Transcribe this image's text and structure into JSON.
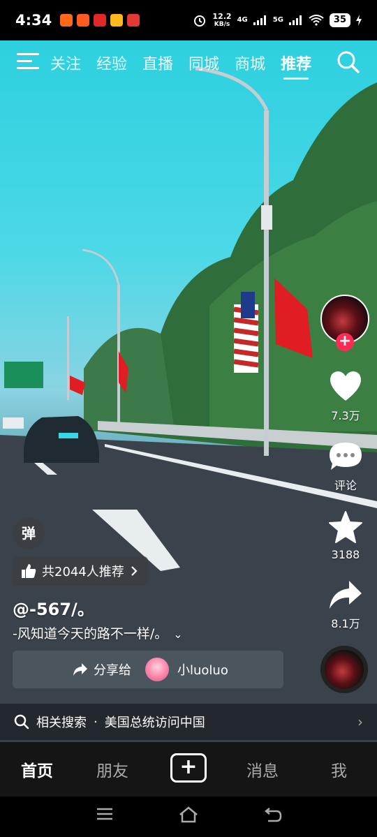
{
  "status": {
    "time": "4:34",
    "net_speed_value": "12.2",
    "net_speed_unit": "KB/s",
    "signal1": "4G",
    "signal2": "5G",
    "battery": "35"
  },
  "topnav": {
    "tabs": [
      {
        "label": "关注",
        "active": false
      },
      {
        "label": "经验",
        "active": false
      },
      {
        "label": "直播",
        "active": false
      },
      {
        "label": "同城",
        "active": false
      },
      {
        "label": "商城",
        "active": false
      },
      {
        "label": "推荐",
        "active": true
      }
    ]
  },
  "rail": {
    "like_count": "7.3万",
    "comment_label": "评论",
    "favorite_count": "3188",
    "share_count": "8.1万"
  },
  "video_info": {
    "danmu_label": "弹",
    "recommend_text": "共2044人推荐",
    "author": "@-567/。",
    "caption": "-风知道今天的路不一样/。",
    "share_label": "分享给",
    "share_user": "小luoluo"
  },
  "related_search": {
    "prefix": "相关搜索",
    "dot": "·",
    "query": "美国总统访问中国"
  },
  "bottomnav": {
    "home": "首页",
    "friends": "朋友",
    "messages": "消息",
    "me": "我"
  },
  "colors": {
    "accent": "#fe2c55",
    "bottom_bar": "#151515"
  }
}
